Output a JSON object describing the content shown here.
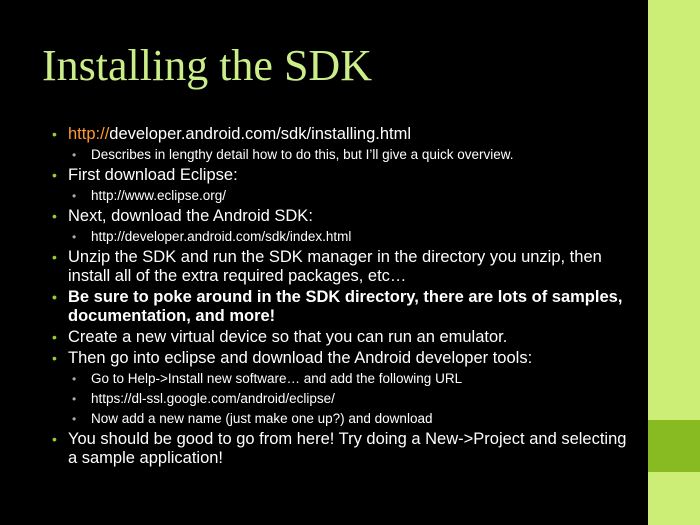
{
  "slide": {
    "title": "Installing the SDK",
    "bullet_glyph": "•",
    "items": [
      {
        "level": 1,
        "prefix": "http://",
        "text": "developer.android.com/sdk/installing.html"
      },
      {
        "level": 2,
        "text": "Describes in lengthy detail how to do this, but I’ll give a quick overview."
      },
      {
        "level": 1,
        "text": "First download Eclipse:"
      },
      {
        "level": 2,
        "text": "http://www.eclipse.org/"
      },
      {
        "level": 1,
        "text": "Next, download the Android SDK:"
      },
      {
        "level": 2,
        "text": "http://developer.android.com/sdk/index.html"
      },
      {
        "level": 1,
        "text": "Unzip the SDK and run the SDK manager in the directory you unzip, then install all of the extra required packages, etc…"
      },
      {
        "level": 1,
        "bold": true,
        "text": "Be sure to poke around in the SDK directory, there are lots of samples, documentation, and more!"
      },
      {
        "level": 1,
        "text": "Create a new virtual device so that you can run an emulator."
      },
      {
        "level": 1,
        "text": "Then go into eclipse and download the Android developer tools:"
      },
      {
        "level": 2,
        "text": "Go to Help->Install new software… and add the following URL"
      },
      {
        "level": 2,
        "text": "https://dl-ssl.google.com/android/eclipse/"
      },
      {
        "level": 2,
        "text": "Now add a new name (just make one up?) and download"
      },
      {
        "level": 1,
        "text": "You should be good to go from here! Try doing a New->Project and selecting a sample application!"
      }
    ]
  },
  "colors": {
    "background": "#000000",
    "title": "#ccee88",
    "text": "#ffffff",
    "link_prefix": "#ff9933",
    "bullet_level1": "#99cc33",
    "sidebar": "#ccee77",
    "sidebar_accent": "#88bb22"
  }
}
